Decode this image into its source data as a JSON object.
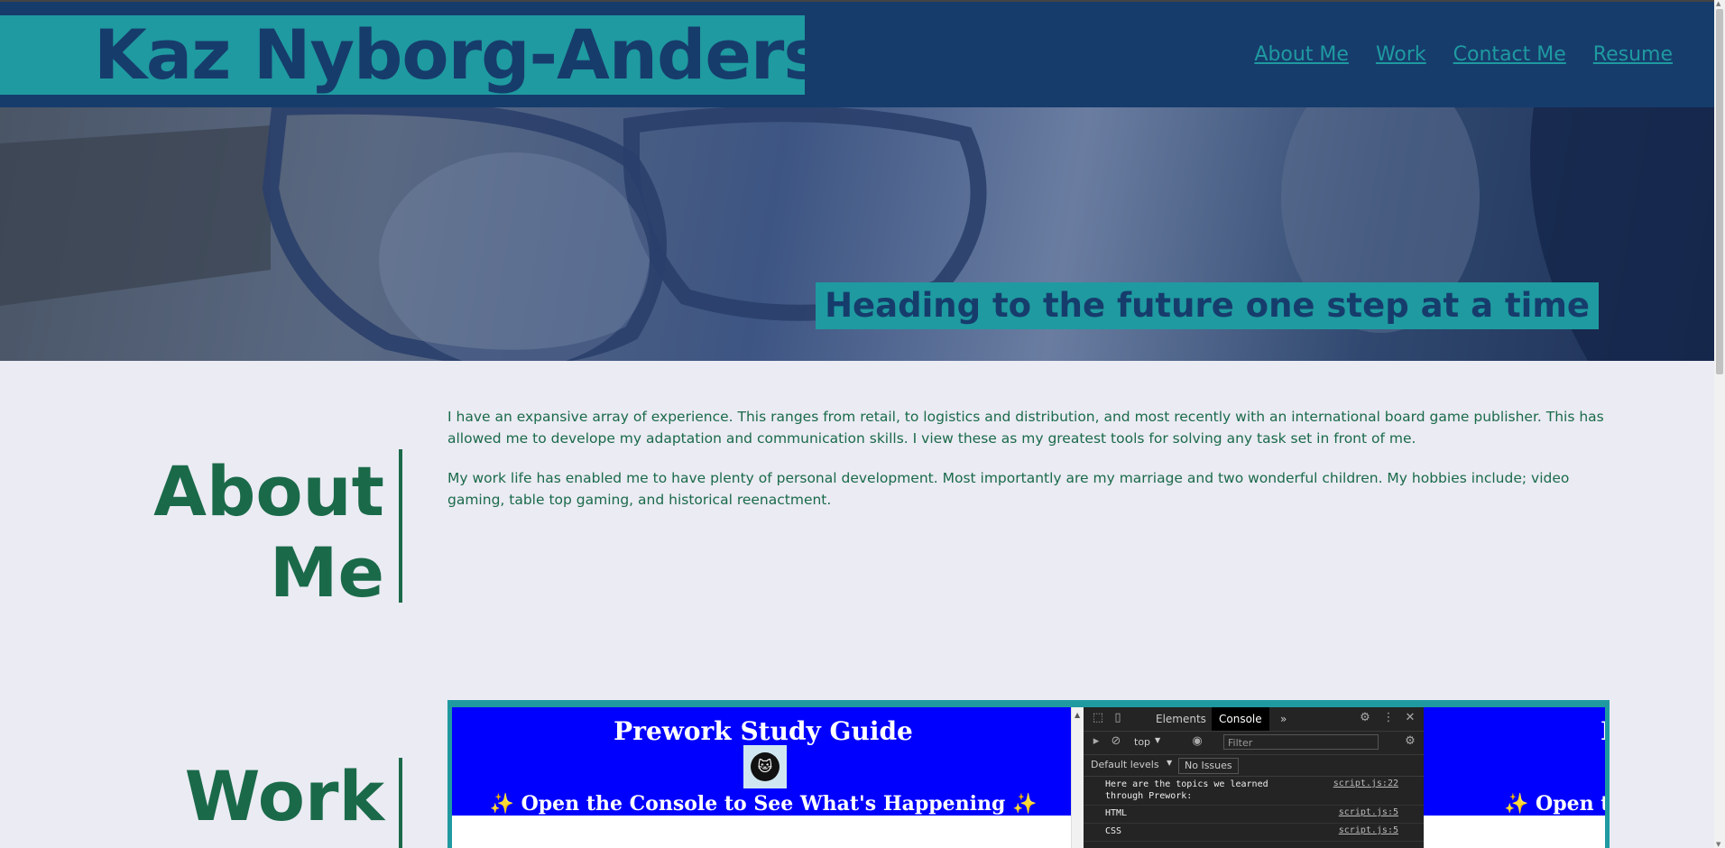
{
  "header": {
    "name": "Kaz Nyborg-Andersen",
    "nav": [
      {
        "label": "About Me"
      },
      {
        "label": "Work"
      },
      {
        "label": "Contact Me"
      },
      {
        "label": "Resume"
      }
    ]
  },
  "hero": {
    "tagline": "Heading to the future one step at a time"
  },
  "about": {
    "title": "About Me",
    "paragraphs": [
      "I have an expansive array of experience. This ranges from retail, to logistics and distribution, and most recently with an international board game publisher. This has allowed me to develope my adaptation and communication skills. I view these as my greatest tools for solving any task set in front of me.",
      "My work life has enabled me to have plenty of personal development. Most importantly are my marriage and two wonderful children. My hobbies include; video gaming, table top gaming, and historical reenactment."
    ]
  },
  "work": {
    "title": "Work",
    "preview": {
      "title": "Prework Study Guide",
      "subtitle": "✨ Open the Console to See What's Happening ✨",
      "right_title_fragment": "P",
      "right_subtitle_fragment": "✨ Open th",
      "devtools": {
        "tabs": [
          "Elements",
          "Console",
          "»"
        ],
        "active_tab": "Console",
        "context": "top",
        "filter_placeholder": "Filter",
        "levels": "Default levels",
        "issues": "No Issues",
        "messages": [
          {
            "text": "Here are the topics we learned through Prework:",
            "source": "script.js:22"
          },
          {
            "text": "HTML",
            "source": "script.js:5"
          },
          {
            "text": "CSS",
            "source": "script.js:5"
          }
        ]
      }
    }
  },
  "colors": {
    "header_bg": "#163c6c",
    "accent": "#1f9aa0",
    "text_green": "#1a6a4a",
    "page_bg": "#ebebf3"
  }
}
